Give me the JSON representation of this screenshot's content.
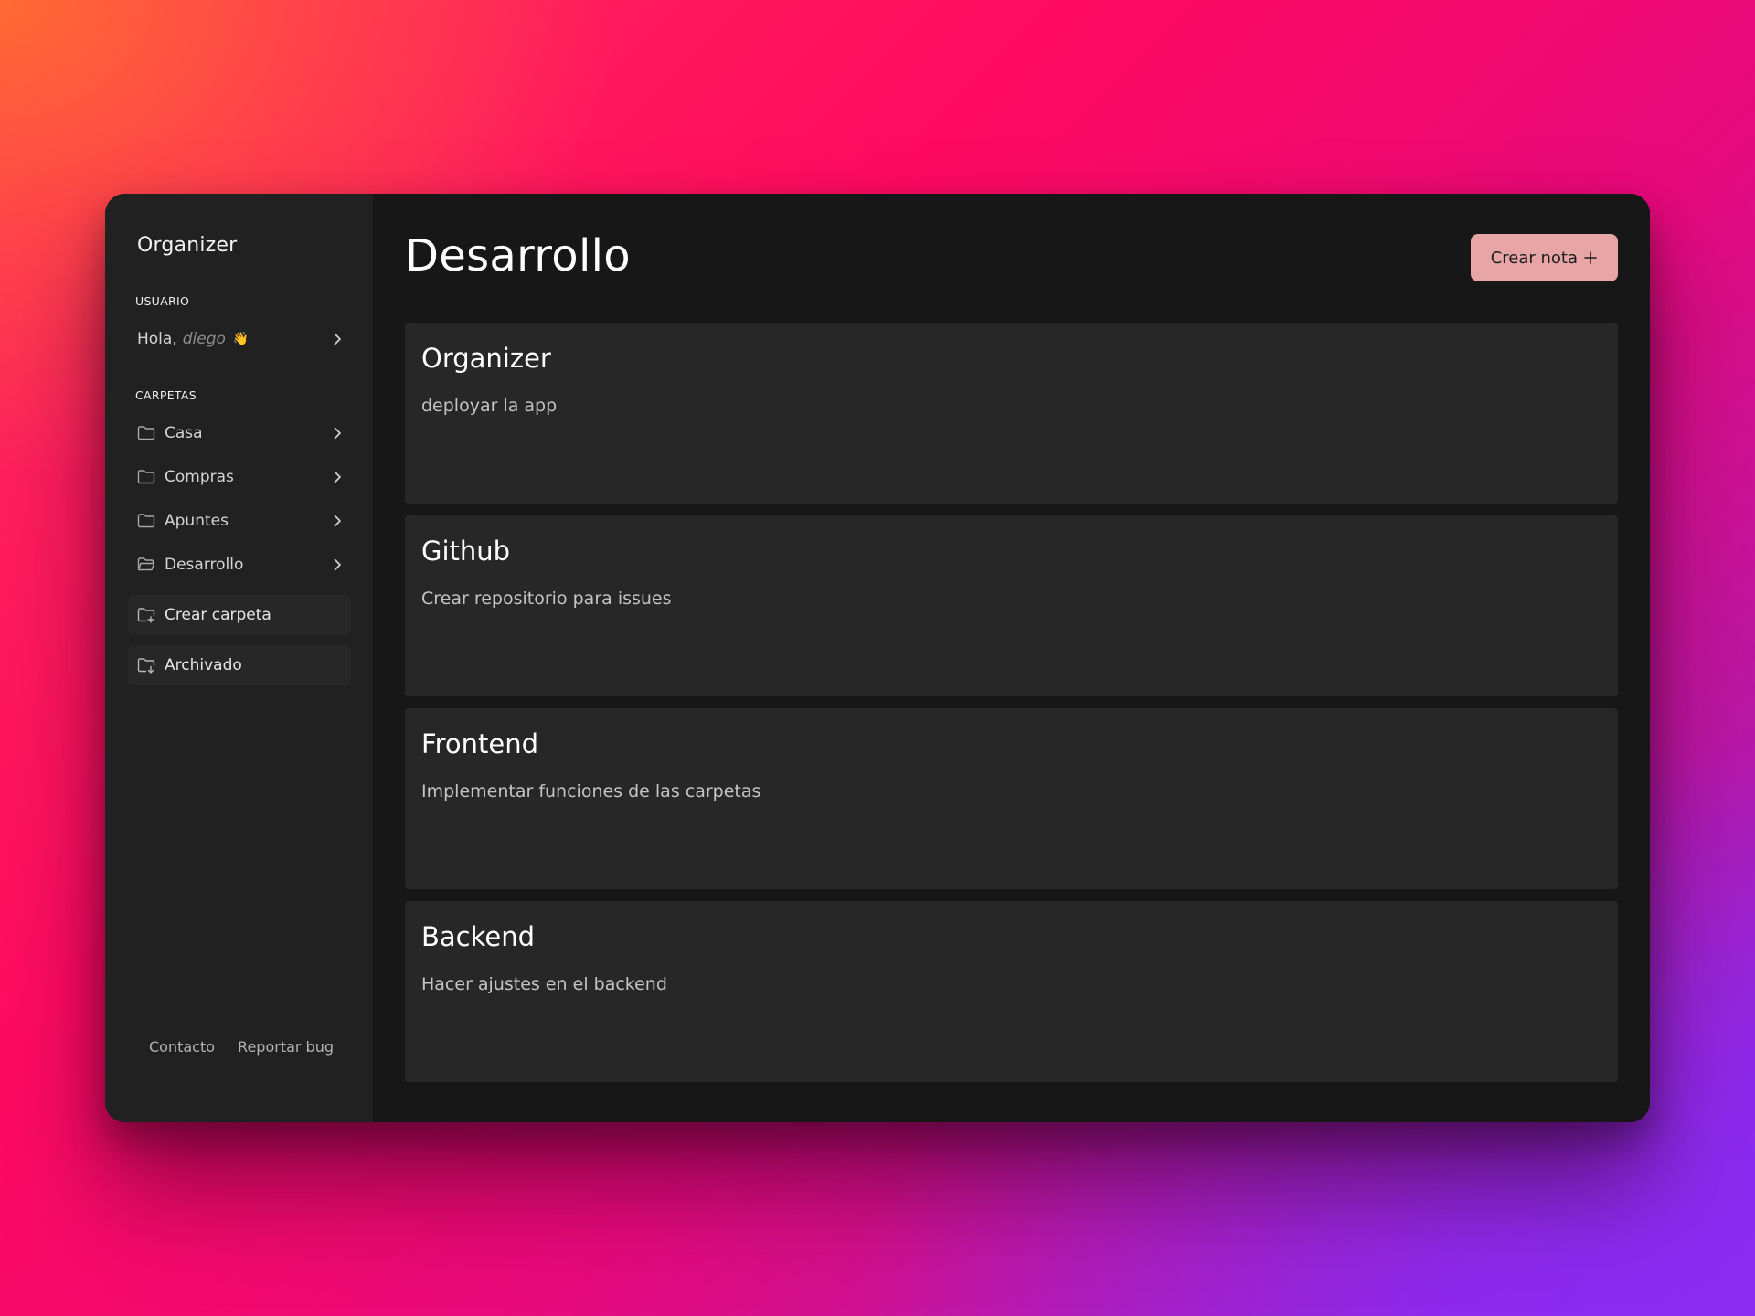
{
  "sidebar": {
    "app_title": "Organizer",
    "user_section_label": "USUARIO",
    "greeting": "Hola,",
    "username": "diego",
    "wave_emoji": "👋",
    "folders_section_label": "CARPETAS",
    "folders": [
      {
        "label": "Casa",
        "icon": "folder-icon"
      },
      {
        "label": "Compras",
        "icon": "folder-icon"
      },
      {
        "label": "Apuntes",
        "icon": "folder-icon"
      },
      {
        "label": "Desarrollo",
        "icon": "folder-open-icon"
      }
    ],
    "create_folder_label": "Crear carpeta",
    "archived_label": "Archivado",
    "footer": {
      "contact": "Contacto",
      "report_bug": "Reportar bug"
    }
  },
  "main": {
    "title": "Desarrollo",
    "create_button_label": "Crear nota",
    "create_button_icon": "plus-icon",
    "notes": [
      {
        "title": "Organizer",
        "body": "deployar la app"
      },
      {
        "title": "Github",
        "body": "Crear repositorio para issues"
      },
      {
        "title": "Frontend",
        "body": "Implementar funciones de las carpetas"
      },
      {
        "title": "Backend",
        "body": "Hacer ajustes en el backend"
      }
    ]
  },
  "colors": {
    "accent_button": "#e8a5a6",
    "sidebar_bg": "#212121",
    "main_bg": "#171717",
    "card_bg": "#272727"
  }
}
